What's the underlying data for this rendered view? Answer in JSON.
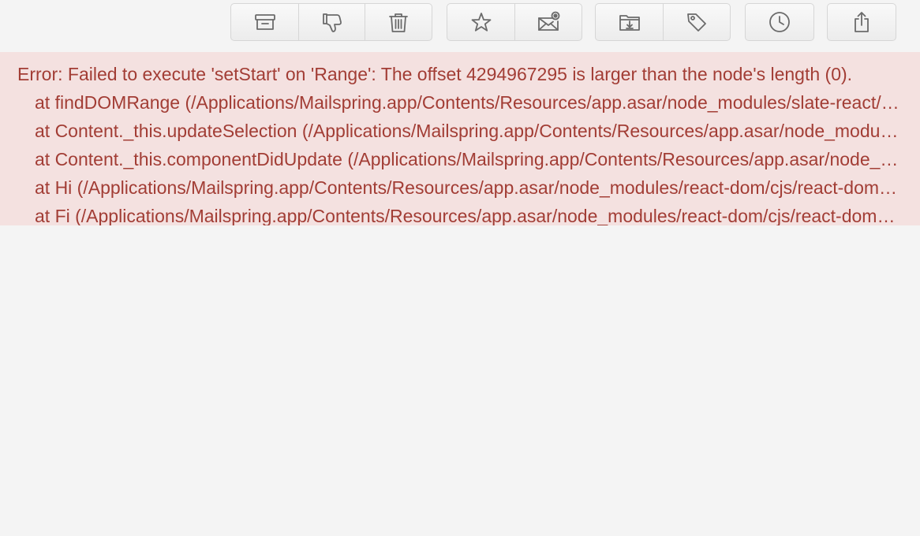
{
  "toolbar": {
    "groups": [
      {
        "buttons": [
          {
            "icon": "archive-icon",
            "label": "Archive"
          },
          {
            "icon": "thumbs-down-icon",
            "label": "Not junk / Spam"
          },
          {
            "icon": "trash-icon",
            "label": "Trash"
          }
        ]
      },
      {
        "buttons": [
          {
            "icon": "star-icon",
            "label": "Star"
          },
          {
            "icon": "mark-unread-icon",
            "label": "Mark as unread"
          }
        ]
      },
      {
        "buttons": [
          {
            "icon": "move-to-folder-icon",
            "label": "Move to folder"
          },
          {
            "icon": "tag-icon",
            "label": "Apply label"
          }
        ]
      },
      {
        "buttons": [
          {
            "icon": "clock-icon",
            "label": "Snooze"
          }
        ]
      },
      {
        "buttons": [
          {
            "icon": "share-icon",
            "label": "Share"
          }
        ]
      }
    ]
  },
  "error": {
    "message": "Error: Failed to execute 'setStart' on 'Range': The offset 4294967295 is larger than the node's length (0).",
    "trace": [
      "at findDOMRange (/Applications/Mailspring.app/Contents/Resources/app.asar/node_modules/slate-react/lib/slate-react.js)",
      "at Content._this.updateSelection (/Applications/Mailspring.app/Contents/Resources/app.asar/node_modules/slate-react/lib/slate-react.js)",
      "at Content._this.componentDidUpdate (/Applications/Mailspring.app/Contents/Resources/app.asar/node_modules/slate-react/lib/slate-react.js)",
      "at Hi (/Applications/Mailspring.app/Contents/Resources/app.asar/node_modules/react-dom/cjs/react-dom.production.min.js)",
      "at Fi (/Applications/Mailspring.app/Contents/Resources/app.asar/node_modules/react-dom/cjs/react-dom.production.min.js)"
    ]
  },
  "colors": {
    "background": "#f4f4f4",
    "error_background": "#f4e1e0",
    "error_text": "#a23d35",
    "icon": "#6b6b6b"
  }
}
